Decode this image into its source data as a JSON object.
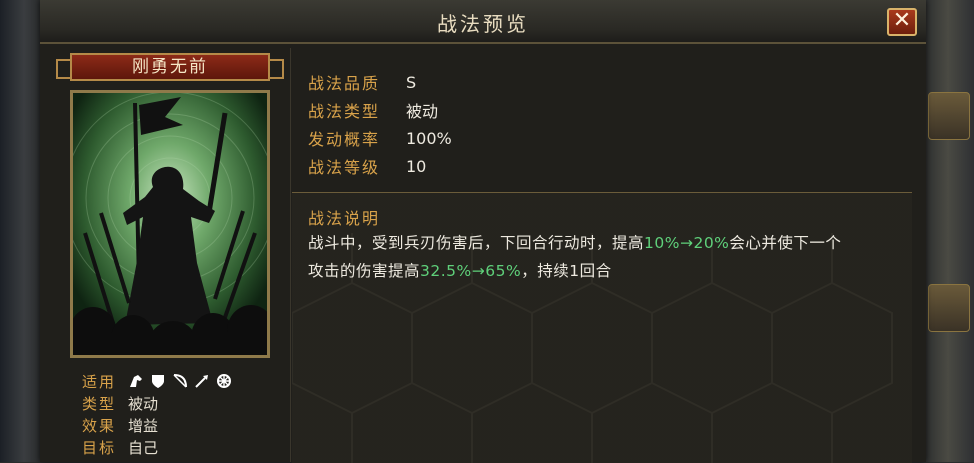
{
  "header": {
    "title": "战法预览",
    "close_icon": "close-icon"
  },
  "skill": {
    "name": "刚勇无前",
    "portrait_icon": "warrior-banner-portrait"
  },
  "meta": {
    "suit_label": "适用",
    "troop_icons": [
      "cavalry-icon",
      "shield-icon",
      "bow-icon",
      "spear-icon",
      "siege-icon"
    ],
    "type_label": "类型",
    "type_value": "被动",
    "effect_label": "效果",
    "effect_value": "增益",
    "target_label": "目标",
    "target_value": "自己"
  },
  "attributes": [
    {
      "label": "战法品质",
      "value": "S"
    },
    {
      "label": "战法类型",
      "value": "被动"
    },
    {
      "label": "发动概率",
      "value": "100%"
    },
    {
      "label": "战法等级",
      "value": "10"
    }
  ],
  "description": {
    "title": "战法说明",
    "line1_a": "战斗中，受到兵刃伤害后，下回合行动时，提高",
    "line1_hl": "10%→20%",
    "line1_b": "会心并使下一个",
    "line2_a": "攻击的伤害提高",
    "line2_hl": "32.5%→65%",
    "line2_b": "，持续1回合",
    "highlight_color": "#5fd07a"
  },
  "colors": {
    "label": "#d8a24a",
    "value": "#eeeae0",
    "accent_red": "#8c2a18"
  }
}
